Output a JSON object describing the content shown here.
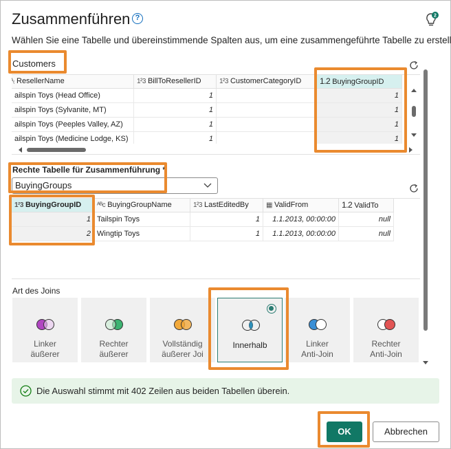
{
  "dialog": {
    "title": "Zusammenführen",
    "help_icon": "help-circle-icon",
    "lightbulb_icon": "lightbulb-icon",
    "subtitle": "Wählen Sie eine Tabelle und übereinstimmende Spalten aus, um eine zusammengeführte Tabelle zu erstellen."
  },
  "left_table": {
    "name": "Customers",
    "columns": [
      {
        "type": "ABC",
        "name": "ResellerName"
      },
      {
        "type": "123",
        "name": "BillToResellerID"
      },
      {
        "type": "123",
        "name": "CustomerCategoryID"
      },
      {
        "type": "1.2",
        "name": "BuyingGroupID"
      }
    ],
    "rows": [
      [
        "ailspin Toys (Head Office)",
        "1",
        "",
        "1"
      ],
      [
        "ailspin Toys (Sylvanite, MT)",
        "1",
        "",
        "1"
      ],
      [
        "ailspin Toys (Peeples Valley, AZ)",
        "1",
        "",
        "1"
      ],
      [
        "ailspin Toys (Medicine Lodge, KS)",
        "1",
        "",
        "1"
      ]
    ]
  },
  "right_table": {
    "label": "Rechte Tabelle für Zusammenführung *",
    "selected": "BuyingGroups",
    "columns": [
      {
        "type": "123",
        "name": "BuyingGroupID"
      },
      {
        "type": "ABC",
        "name": "BuyingGroupName"
      },
      {
        "type": "123",
        "name": "LastEditedBy"
      },
      {
        "type": "date",
        "name": "ValidFrom"
      },
      {
        "type": "1.2",
        "name": "ValidTo"
      }
    ],
    "rows": [
      [
        "1",
        "Tailspin Toys",
        "1",
        "1.1.2013, 00:00:00",
        "null"
      ],
      [
        "2",
        "Wingtip Toys",
        "1",
        "1.1.2013, 00:00:00",
        "null"
      ]
    ]
  },
  "join": {
    "label": "Art des Joins",
    "options": [
      {
        "label": "Linker\näußerer",
        "selected": false
      },
      {
        "label": "Rechter\näußerer",
        "selected": false
      },
      {
        "label": "Vollständig\näußerer Joi",
        "selected": false
      },
      {
        "label": "Innerhalb",
        "selected": true
      },
      {
        "label": "Linker\nAnti-Join",
        "selected": false
      },
      {
        "label": "Rechter\nAnti-Join",
        "selected": false
      }
    ]
  },
  "status": {
    "message": "Die Auswahl stimmt mit 402 Zeilen aus beiden Tabellen überein.",
    "icon": "check-circle-icon"
  },
  "buttons": {
    "ok": "OK",
    "cancel": "Abbrechen"
  },
  "colors": {
    "accent": "#117865",
    "highlight": "#ea8a2f",
    "selected_column": "#d6f0ef",
    "success_bg": "#e7f4e8"
  }
}
